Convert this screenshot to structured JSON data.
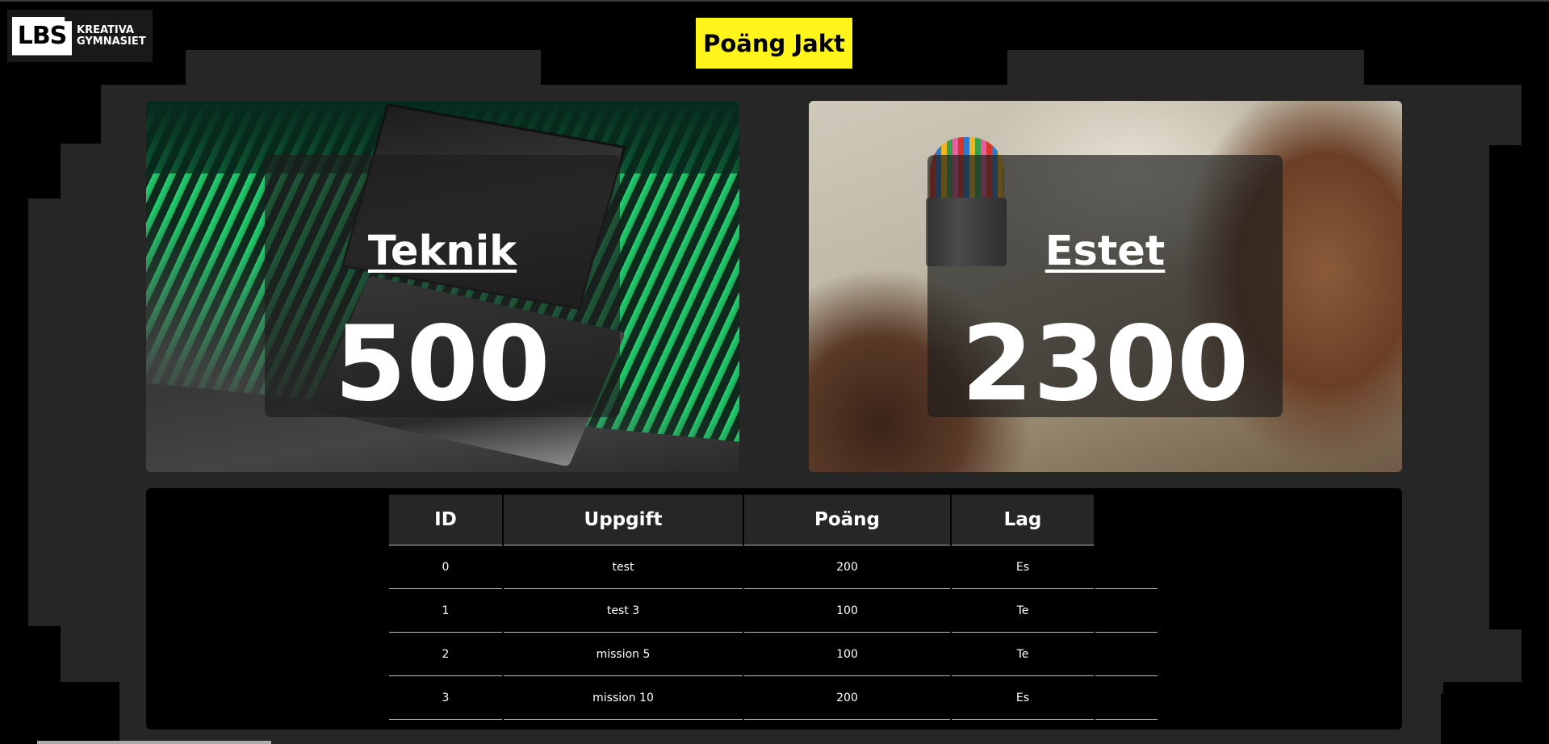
{
  "logo": {
    "mark": "LBS",
    "line1": "KREATIVA",
    "line2": "GYMNASIET"
  },
  "title": "Poäng Jakt",
  "teams": [
    {
      "name": "Teknik",
      "score": "500",
      "accent": "#22d472"
    },
    {
      "name": "Estet",
      "score": "2300",
      "accent": "#bdb6a4"
    }
  ],
  "table": {
    "headers": [
      "ID",
      "Uppgift",
      "Poäng",
      "Lag"
    ],
    "rows": [
      {
        "id": "0",
        "uppgift": "test",
        "poang": "200",
        "lag": "Es"
      },
      {
        "id": "1",
        "uppgift": "test 3",
        "poang": "100",
        "lag": "Te"
      },
      {
        "id": "2",
        "uppgift": "mission 5",
        "poang": "100",
        "lag": "Te"
      },
      {
        "id": "3",
        "uppgift": "mission 10",
        "poang": "200",
        "lag": "Es"
      }
    ]
  },
  "colors": {
    "title_bg": "#fff51a",
    "page_bg": "#000000",
    "panel_bg": "#262626"
  }
}
